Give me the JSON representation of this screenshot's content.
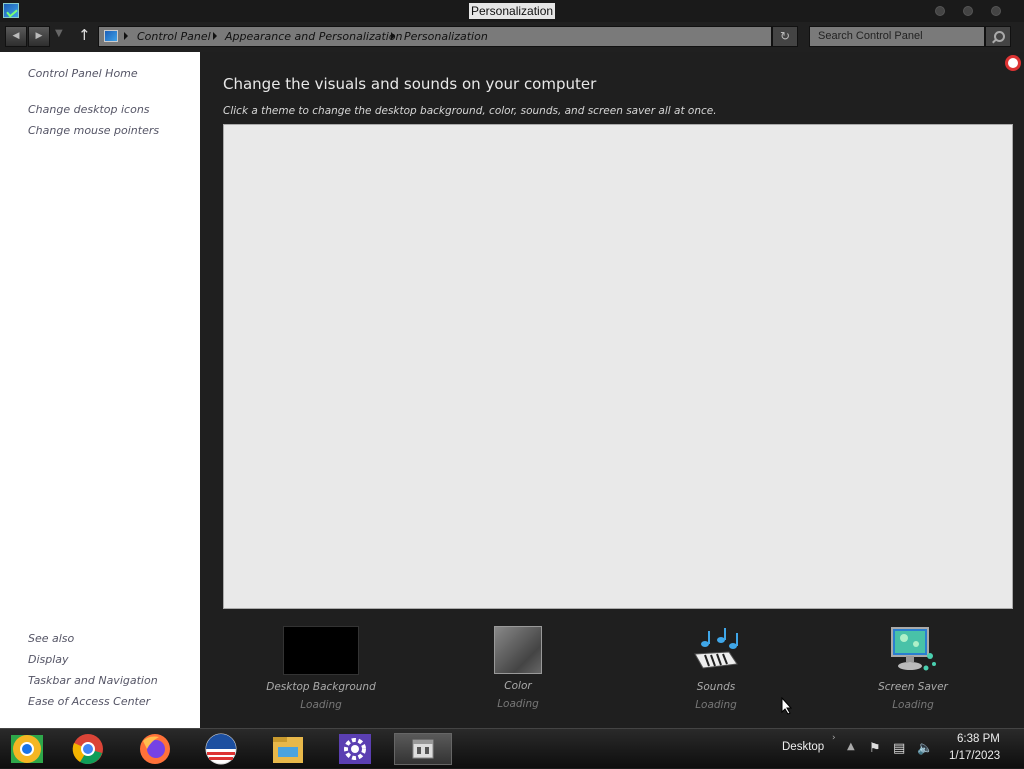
{
  "window": {
    "title": "Personalization"
  },
  "nav": {
    "breadcrumbs": [
      "Control Panel",
      "Appearance and Personalization",
      "Personalization"
    ],
    "search_placeholder": "Search Control Panel"
  },
  "sidebar": {
    "home": "Control Panel Home",
    "links": [
      "Change desktop icons",
      "Change mouse pointers"
    ],
    "see_also_title": "See also",
    "see_also": [
      "Display",
      "Taskbar and Navigation",
      "Ease of Access Center"
    ]
  },
  "main": {
    "heading": "Change the visuals and sounds on your computer",
    "subtext": "Click a theme to change the desktop background, color, sounds, and screen saver all at once.",
    "options": [
      {
        "label": "Desktop Background",
        "status": "Loading",
        "icon": "desktop-background-thumb"
      },
      {
        "label": "Color",
        "status": "Loading",
        "icon": "color-thumb"
      },
      {
        "label": "Sounds",
        "status": "Loading",
        "icon": "sounds-icon"
      },
      {
        "label": "Screen Saver",
        "status": "Loading",
        "icon": "screen-saver-icon"
      }
    ]
  },
  "taskbar": {
    "apps": [
      "chrome-canary-icon",
      "chrome-icon",
      "firefox-icon",
      "obama-logo-icon",
      "file-explorer-icon",
      "settings-gear-icon",
      "control-panel-icon"
    ],
    "desktop_label": "Desktop",
    "time": "6:38 PM",
    "date": "1/17/2023"
  },
  "colors": {
    "titlebar": "#1a1a1a",
    "main_bg": "#1f1f1f",
    "sidebar_bg": "#ffffff",
    "theme_area": "#e9e9e9",
    "help_icon_red": "#dd3333",
    "settings_purple": "#5b3fb2"
  }
}
